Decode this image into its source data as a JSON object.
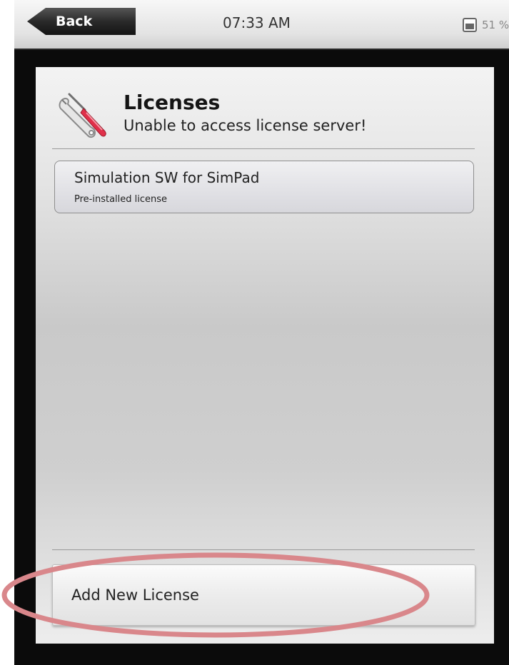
{
  "status_bar": {
    "back_label": "Back",
    "time": "07:33 AM",
    "battery": "51 %",
    "battery_icon": "battery-icon"
  },
  "header": {
    "icon": "tools-icon",
    "title": "Licenses",
    "subtitle": "Unable to access license server!"
  },
  "licenses": [
    {
      "name": "Simulation SW for SimPad",
      "description": "Pre-installed license"
    }
  ],
  "footer": {
    "add_label": "Add New License"
  },
  "colors": {
    "highlight_ring": "#d9878b",
    "back_button": "#2a2a2a",
    "screwdriver_handle": "#e0304a"
  }
}
